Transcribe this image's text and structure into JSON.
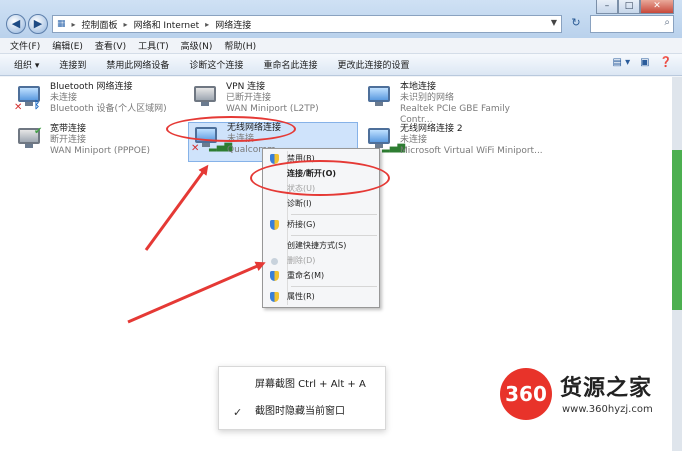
{
  "window": {
    "minimize": "–",
    "maximize": "□",
    "close": "✕"
  },
  "address": {
    "segments": [
      "控制面板",
      "网络和 Internet",
      "网络连接"
    ],
    "separator": "▸"
  },
  "menubar": [
    "文件(F)",
    "编辑(E)",
    "查看(V)",
    "工具(T)",
    "高级(N)",
    "帮助(H)"
  ],
  "toolbar": {
    "items": [
      "组织 ▾",
      "连接到",
      "禁用此网络设备",
      "诊断这个连接",
      "重命名此连接",
      "更改此连接的设置"
    ]
  },
  "connections": [
    {
      "name": "Bluetooth 网络连接",
      "status": "未连接",
      "device": "Bluetooth 设备(个人区域网)"
    },
    {
      "name": "VPN 连接",
      "status": "已断开连接",
      "device": "WAN Miniport (L2TP)"
    },
    {
      "name": "本地连接",
      "status": "未识别的网络",
      "device": "Realtek PCIe GBE Family Contr..."
    },
    {
      "name": "宽带连接",
      "status": "断开连接",
      "device": "WAN Miniport (PPPOE)"
    },
    {
      "name": "无线网络连接",
      "status": "未连接",
      "device": "Qualcomm"
    },
    {
      "name": "无线网络连接 2",
      "status": "未连接",
      "device": "Microsoft Virtual WiFi Miniport..."
    }
  ],
  "context_menu": [
    {
      "label": "禁用(B)"
    },
    {
      "label": "连接/断开(O)"
    },
    {
      "label": "状态(U)"
    },
    {
      "label": "诊断(I)"
    },
    {
      "label": "桥接(G)"
    },
    {
      "label": "创建快捷方式(S)"
    },
    {
      "label": "删除(D)"
    },
    {
      "label": "重命名(M)"
    },
    {
      "label": "属性(R)"
    }
  ],
  "popup": {
    "row1": "屏幕截图 Ctrl + Alt + A",
    "row2": "截图时隐藏当前窗口",
    "check": "✓"
  },
  "watermark": {
    "badge": "360",
    "brand": "货源之家",
    "url": "www.360hyzj.com"
  },
  "colors": {
    "annotation": "#e53935",
    "selection": "#cfe3fb"
  }
}
